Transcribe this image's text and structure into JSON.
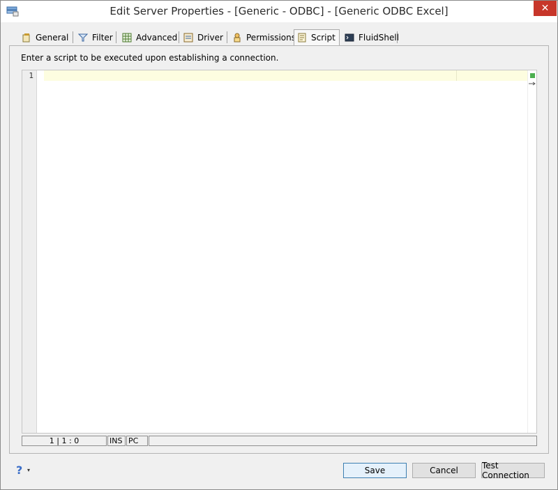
{
  "window": {
    "title": "Edit Server Properties - [Generic - ODBC] - [Generic ODBC Excel]",
    "close_glyph": "✕"
  },
  "tabs": [
    {
      "label": "General",
      "icon": "general-icon"
    },
    {
      "label": "Filter",
      "icon": "filter-icon"
    },
    {
      "label": "Advanced",
      "icon": "advanced-icon"
    },
    {
      "label": "Driver",
      "icon": "driver-icon"
    },
    {
      "label": "Permissions",
      "icon": "permissions-icon"
    },
    {
      "label": "Script",
      "icon": "script-icon",
      "active": true
    },
    {
      "label": "FluidShell",
      "icon": "fluidshell-icon"
    }
  ],
  "script_panel": {
    "instruction": "Enter a script to be executed upon establishing a connection.",
    "line_numbers": [
      "1"
    ]
  },
  "status_bar": {
    "position": "1 | 1 : 0",
    "mode": "INS",
    "line_ending": "PC",
    "message": ""
  },
  "footer": {
    "help_glyph": "?",
    "dropdown_glyph": "▾",
    "save_label": "Save",
    "cancel_label": "Cancel",
    "test_label": "Test Connection"
  },
  "colors": {
    "accent": "#3c7fb1",
    "close_button": "#c7362a",
    "current_line": "#fdfde0",
    "overview_marker": "#4caf50"
  }
}
